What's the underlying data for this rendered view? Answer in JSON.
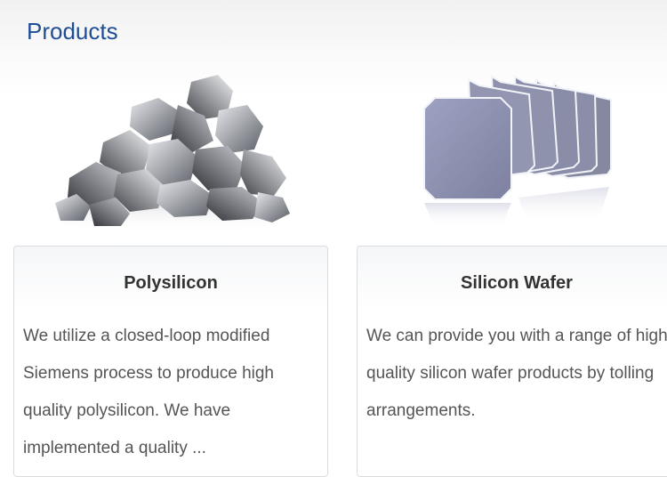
{
  "section": {
    "title": "Products"
  },
  "products": [
    {
      "title": "Polysilicon",
      "description": "We utilize a closed-loop modified Siemens process to produce high quality polysilicon. We have implemented a quality ...",
      "image_icon": "polysilicon-chunks"
    },
    {
      "title": "Silicon Wafer",
      "description": "We can provide you with a range of high quality silicon wafer products by tolling arrangements.",
      "image_icon": "silicon-wafers-stack"
    }
  ],
  "colors": {
    "title_blue": "#1f4e97",
    "card_border": "#d9dde2",
    "wafer": "#8a8fad"
  }
}
